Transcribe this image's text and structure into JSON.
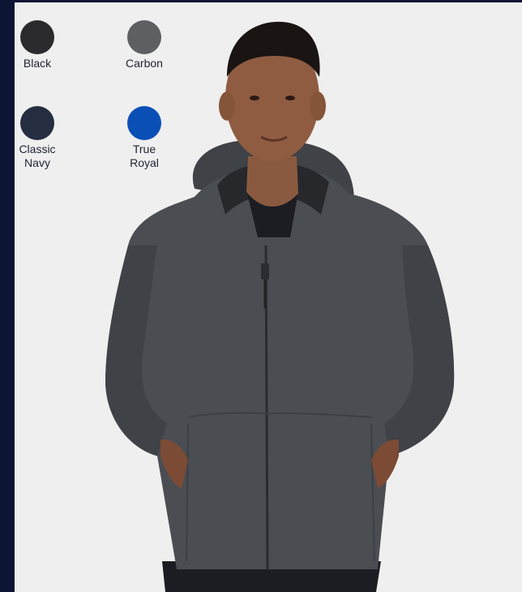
{
  "swatches": [
    {
      "label": "Black",
      "color": "#2b2b2d"
    },
    {
      "label": "Carbon",
      "color": "#5d5f63"
    },
    {
      "label": "Classic\nNavy",
      "color": "#252d41"
    },
    {
      "label": "True\nRoyal",
      "color": "#0a4fb6"
    }
  ],
  "product_image": {
    "subject": "hooded-jacket-model",
    "jacket_color": "#4a4d52"
  }
}
